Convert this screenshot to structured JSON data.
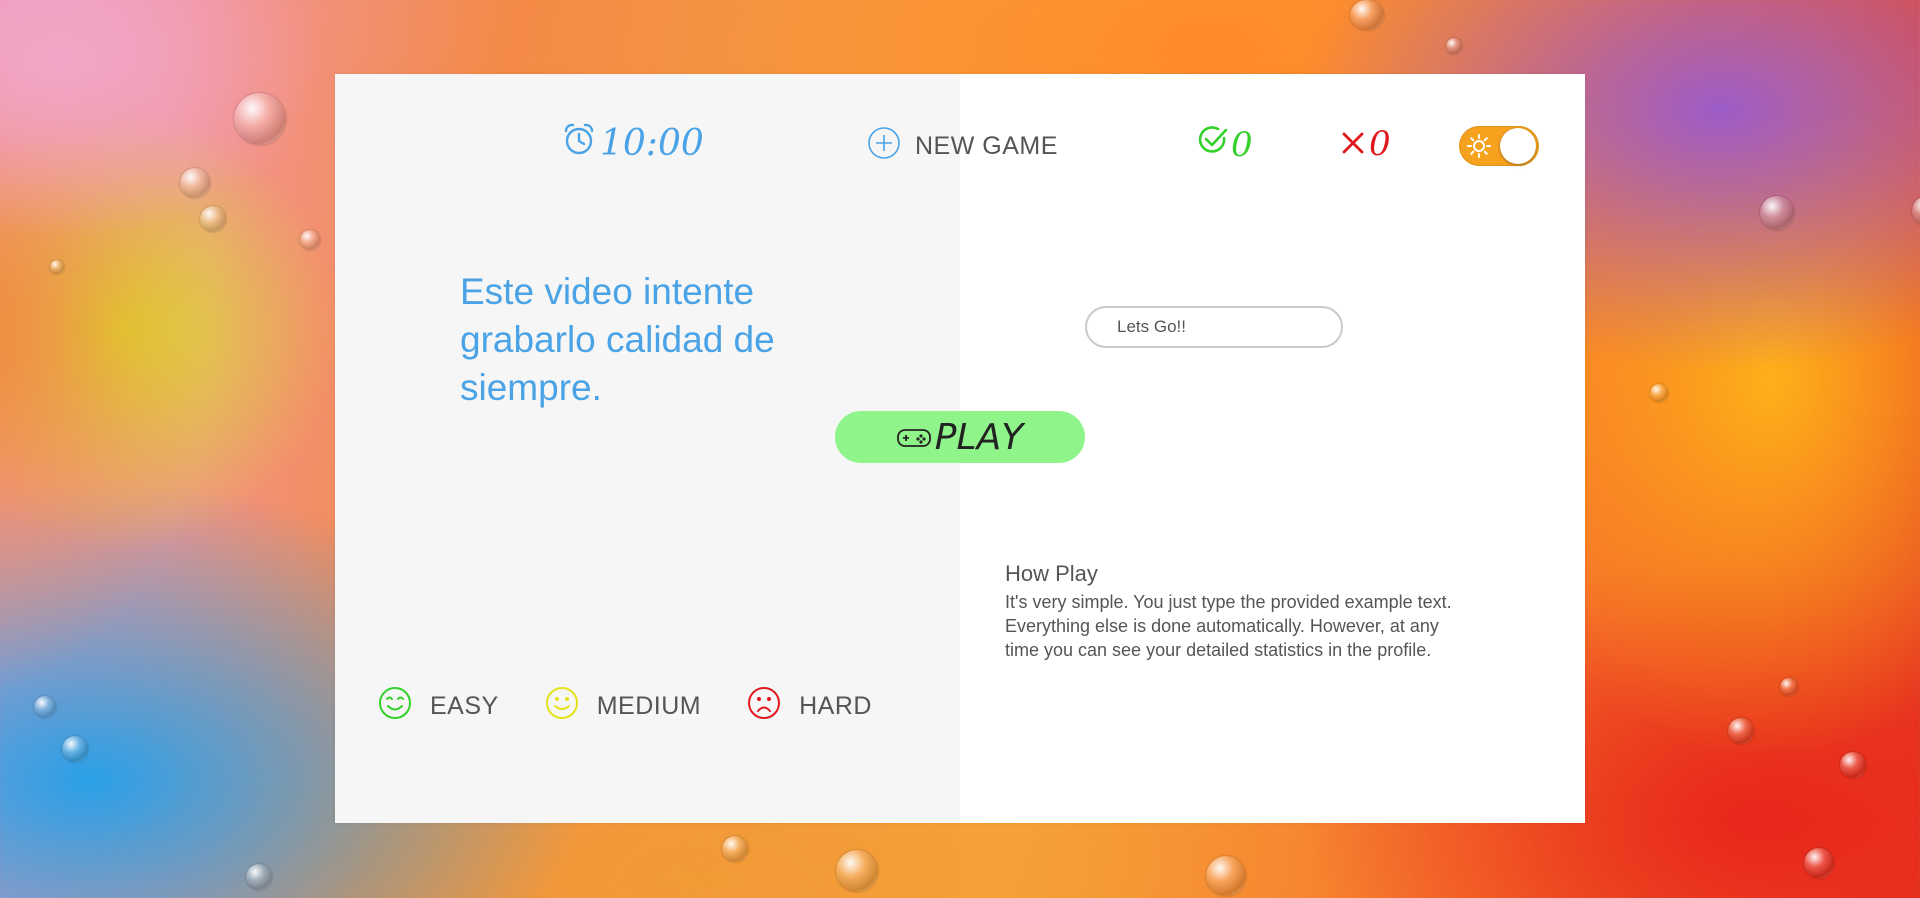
{
  "header": {
    "timer": "10:00",
    "new_game_label": "NEW GAME",
    "correct_count": "0",
    "wrong_count": "0"
  },
  "game": {
    "sample_text": "Este video intente grabarlo calidad de siempre.",
    "input_placeholder": "Lets Go!!",
    "play_label": "PLAY"
  },
  "how_play": {
    "title": "How Play",
    "body": "It's very simple. You just type the provided example text. Everything else is done automatically. However, at any time you can see your detailed statistics in the profile."
  },
  "difficulty": {
    "easy": "EASY",
    "medium": "MEDIUM",
    "hard": "HARD"
  },
  "colors": {
    "accent_blue": "#4aa3e6",
    "correct_green": "#33d12a",
    "wrong_red": "#e0181e",
    "play_green": "#8ff58a",
    "toggle_orange": "#f6a21e",
    "medium_yellow": "#e4e21a"
  },
  "icons": {
    "timer": "alarm-clock-icon",
    "new_game": "plus-circle-icon",
    "correct": "check-circle-icon",
    "wrong": "x-icon",
    "theme": "sun-icon",
    "play": "gamepad-icon",
    "easy": "smile-icon",
    "medium": "neutral-face-icon",
    "hard": "sad-face-icon"
  },
  "theme_toggle": {
    "on": true
  }
}
